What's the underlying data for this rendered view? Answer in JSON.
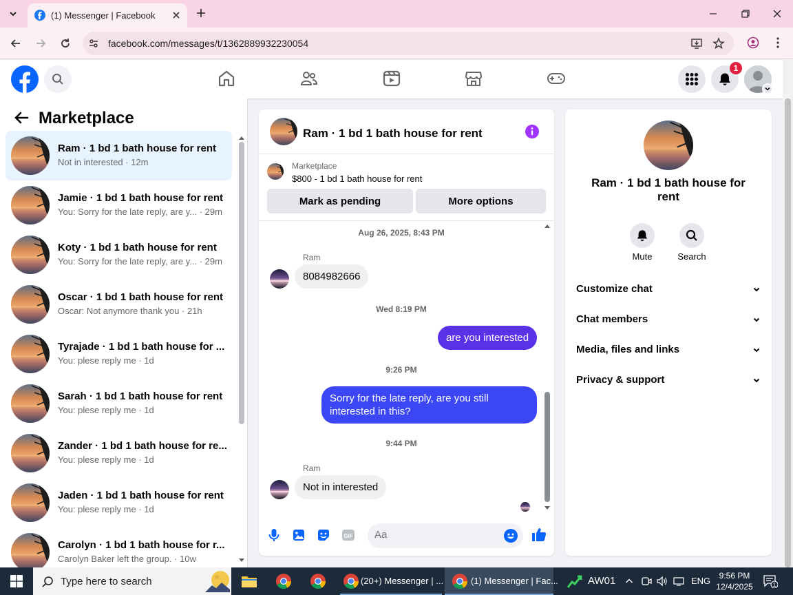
{
  "browser": {
    "tab_title": "(1) Messenger | Facebook",
    "url": "facebook.com/messages/t/1362889932230054"
  },
  "header": {
    "notification_count": "1",
    "accent": "#1877f2"
  },
  "marketplace": {
    "title": "Marketplace",
    "conversations": [
      {
        "name": "Ram · 1 bd 1 bath house for rent",
        "preview": "Not in interested · 12m",
        "active": true
      },
      {
        "name": "Jamie · 1 bd 1 bath house for rent",
        "preview": "You: Sorry for the late reply, are y... · 29m"
      },
      {
        "name": "Koty · 1 bd 1 bath house for rent",
        "preview": "You: Sorry for the late reply, are y... · 29m"
      },
      {
        "name": "Oscar · 1 bd 1 bath house for rent",
        "preview": "Oscar: Not anymore thank you · 21h"
      },
      {
        "name": "Tyrajade · 1 bd 1 bath house for ...",
        "preview": "You: plese reply me · 1d"
      },
      {
        "name": "Sarah · 1 bd 1 bath house for rent",
        "preview": "You: plese reply me · 1d"
      },
      {
        "name": "Zander · 1 bd 1 bath house for re...",
        "preview": "You: plese reply me · 1d"
      },
      {
        "name": "Jaden · 1 bd 1 bath house for rent",
        "preview": "You: plese reply me · 1d"
      },
      {
        "name": "Carolyn · 1 bd 1 bath house for r...",
        "preview": "Carolyn Baker left the group. · 10w"
      }
    ]
  },
  "chat": {
    "title": "Ram · 1 bd 1 bath house for rent",
    "listing_source": "Marketplace",
    "listing_title": "$800 - 1 bd 1 bath house for rent",
    "mark_pending_label": "Mark as pending",
    "more_options_label": "More options",
    "messages": {
      "ts1": "Aug 26, 2025, 8:43 PM",
      "sender1": "Ram",
      "msg1": "8084982666",
      "ts2": "Wed 8:19 PM",
      "msg2": "are you interested",
      "ts3": "9:26 PM",
      "msg3": "Sorry for the late reply, are you still interested in this?",
      "ts4": "9:44 PM",
      "sender4": "Ram",
      "msg4": "Not in interested"
    },
    "composer_placeholder": "Aa",
    "outgoing_color": "#3b47f5"
  },
  "details": {
    "name": "Ram · 1 bd 1 bath house for rent",
    "mute_label": "Mute",
    "search_label": "Search",
    "sections": [
      "Customize chat",
      "Chat members",
      "Media, files and links",
      "Privacy & support"
    ]
  },
  "taskbar": {
    "search_placeholder": "Type here to search",
    "app1_label": "(20+) Messenger | ...",
    "app2_label": "(1) Messenger | Fac...",
    "weather_label": "AW01",
    "language": "ENG",
    "time": "9:56 PM",
    "date": "12/4/2025",
    "notification_count": "1"
  }
}
